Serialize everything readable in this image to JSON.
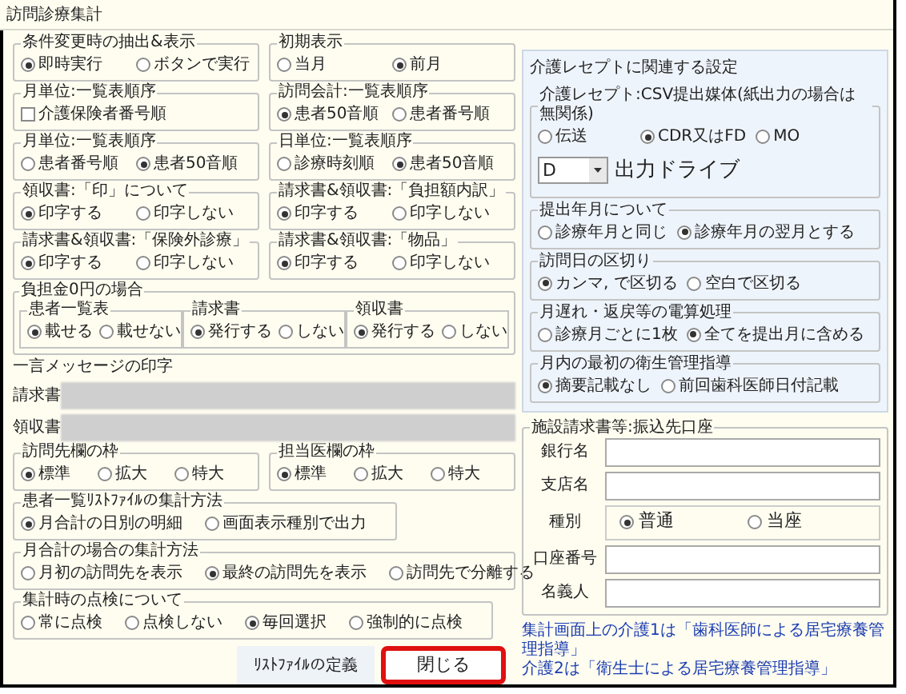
{
  "window": {
    "title": "訪問診療集計"
  },
  "left_sections": [
    {
      "kind": "row",
      "groups": [
        {
          "title": "条件変更時の抽出&表示",
          "kind": "radio",
          "options": [
            {
              "label": "即時実行",
              "selected": true
            },
            {
              "label": "ボタンで実行",
              "selected": false
            }
          ]
        },
        {
          "title": "初期表示",
          "kind": "radio",
          "options": [
            {
              "label": "当月",
              "selected": false
            },
            {
              "label": "前月",
              "selected": true
            }
          ]
        }
      ]
    },
    {
      "kind": "row",
      "groups": [
        {
          "title": "月単位:一覧表順序",
          "kind": "checkbox",
          "options": [
            {
              "label": "介護保険者番号順",
              "checked": false
            }
          ]
        },
        {
          "title": "訪問会計:一覧表順序",
          "kind": "radio",
          "options": [
            {
              "label": "患者50音順",
              "selected": true
            },
            {
              "label": "患者番号順",
              "selected": false
            }
          ]
        }
      ]
    },
    {
      "kind": "row",
      "groups": [
        {
          "title": "月単位:一覧表順序",
          "kind": "radio",
          "options": [
            {
              "label": "患者番号順",
              "selected": false
            },
            {
              "label": "患者50音順",
              "selected": true
            }
          ]
        },
        {
          "title": "日単位:一覧表順序",
          "kind": "radio",
          "options": [
            {
              "label": "診療時刻順",
              "selected": false
            },
            {
              "label": "患者50音順",
              "selected": true
            }
          ]
        }
      ]
    },
    {
      "kind": "row",
      "groups": [
        {
          "title": "領収書:「印」について",
          "kind": "radio",
          "options": [
            {
              "label": "印字する",
              "selected": true
            },
            {
              "label": "印字しない",
              "selected": false
            }
          ]
        },
        {
          "title": "請求書&領収書:「負担額内訳」",
          "kind": "radio",
          "options": [
            {
              "label": "印字する",
              "selected": true
            },
            {
              "label": "印字しない",
              "selected": false
            }
          ]
        }
      ]
    },
    {
      "kind": "row",
      "groups": [
        {
          "title": "請求書&領収書:「保険外診療」",
          "kind": "radio",
          "options": [
            {
              "label": "印字する",
              "selected": true
            },
            {
              "label": "印字しない",
              "selected": false
            }
          ]
        },
        {
          "title": "請求書&領収書:「物品」",
          "kind": "radio",
          "options": [
            {
              "label": "印字する",
              "selected": true
            },
            {
              "label": "印字しない",
              "selected": false
            }
          ]
        }
      ]
    },
    {
      "kind": "nested",
      "title": "負担金0円の場合",
      "groups": [
        {
          "title": "患者一覧表",
          "kind": "radio",
          "options": [
            {
              "label": "載せる",
              "selected": true
            },
            {
              "label": "載せない",
              "selected": false
            }
          ]
        },
        {
          "title": "請求書",
          "kind": "radio",
          "options": [
            {
              "label": "発行する",
              "selected": true
            },
            {
              "label": "しない",
              "selected": false
            }
          ]
        },
        {
          "title": "領収書",
          "kind": "radio",
          "options": [
            {
              "label": "発行する",
              "selected": true
            },
            {
              "label": "しない",
              "selected": false
            }
          ]
        }
      ]
    },
    {
      "kind": "message",
      "title": "一言メッセージの印字",
      "fields": [
        {
          "label": "請求書"
        },
        {
          "label": "領収書"
        }
      ]
    },
    {
      "kind": "row",
      "groups": [
        {
          "title": "訪問先欄の枠",
          "kind": "radio",
          "options": [
            {
              "label": "標準",
              "selected": true
            },
            {
              "label": "拡大",
              "selected": false
            },
            {
              "label": "特大",
              "selected": false
            }
          ]
        },
        {
          "title": "担当医欄の枠",
          "kind": "radio",
          "options": [
            {
              "label": "標準",
              "selected": true
            },
            {
              "label": "拡大",
              "selected": false
            },
            {
              "label": "特大",
              "selected": false
            }
          ]
        }
      ]
    },
    {
      "kind": "row",
      "groups": [
        {
          "title": "患者一覧ﾘｽﾄﾌｧｲﾙの集計方法",
          "kind": "radio",
          "options": [
            {
              "label": "月合計の日別の明細",
              "selected": true
            },
            {
              "label": "画面表示種別で出力",
              "selected": false
            }
          ]
        }
      ]
    },
    {
      "kind": "row",
      "groups": [
        {
          "title": "月合計の場合の集計方法",
          "kind": "radio",
          "options": [
            {
              "label": "月初の訪問先を表示",
              "selected": false
            },
            {
              "label": "最終の訪問先を表示",
              "selected": true
            },
            {
              "label": "訪問先で分離する",
              "selected": false
            }
          ]
        }
      ]
    },
    {
      "kind": "row",
      "groups": [
        {
          "title": "集計時の点検について",
          "kind": "radio",
          "options": [
            {
              "label": "常に点検",
              "selected": false
            },
            {
              "label": "点検しない",
              "selected": false
            },
            {
              "label": "毎回選択",
              "selected": true
            },
            {
              "label": "強制的に点検",
              "selected": false
            }
          ]
        }
      ]
    }
  ],
  "buttons": [
    {
      "label": "ﾘｽﾄﾌｧｲﾙの定義",
      "highlighted": false
    },
    {
      "label": "閉じる",
      "highlighted": true
    }
  ],
  "receipt": {
    "title": "介護レセプトに関連する設定",
    "groups": [
      {
        "title": "介護レセプト:CSV提出媒体(紙出力の場合は無関係)",
        "kind": "radio",
        "options": [
          {
            "label": "伝送",
            "selected": false
          },
          {
            "label": "CDR又はFD",
            "selected": true
          },
          {
            "label": "MO",
            "selected": false
          }
        ],
        "drive": {
          "value": "D",
          "label": "出力ドライブ"
        }
      },
      {
        "title": "提出年月について",
        "kind": "radio",
        "options": [
          {
            "label": "診療年月と同じ",
            "selected": false
          },
          {
            "label": "診療年月の翌月とする",
            "selected": true
          }
        ]
      },
      {
        "title": "訪問日の区切り",
        "kind": "radio",
        "options": [
          {
            "label": "カンマ, で区切る",
            "selected": true
          },
          {
            "label": "空白で区切る",
            "selected": false
          }
        ]
      },
      {
        "title": "月遅れ・返戻等の電算処理",
        "kind": "radio",
        "options": [
          {
            "label": "診療月ごとに1枚",
            "selected": false
          },
          {
            "label": "全てを提出月に含める",
            "selected": true
          }
        ]
      },
      {
        "title": "月内の最初の衛生管理指導",
        "kind": "radio",
        "options": [
          {
            "label": "摘要記載なし",
            "selected": true
          },
          {
            "label": "前回歯科医師日付記載",
            "selected": false
          }
        ]
      }
    ]
  },
  "bank": {
    "title": "施設請求書等:振込先口座",
    "rows": [
      {
        "kind": "field",
        "label": "銀行名"
      },
      {
        "kind": "field",
        "label": "支店名"
      },
      {
        "kind": "radio",
        "label": "種別",
        "options": [
          {
            "label": "普通",
            "selected": true
          },
          {
            "label": "当座",
            "selected": false
          }
        ]
      },
      {
        "kind": "field",
        "label": "口座番号"
      },
      {
        "kind": "field",
        "label": "名義人"
      }
    ]
  },
  "notes": [
    "集計画面上の介護1は「歯科医師による居宅療養管理指導」",
    "介護2は「衛生士による居宅療養管理指導」"
  ]
}
